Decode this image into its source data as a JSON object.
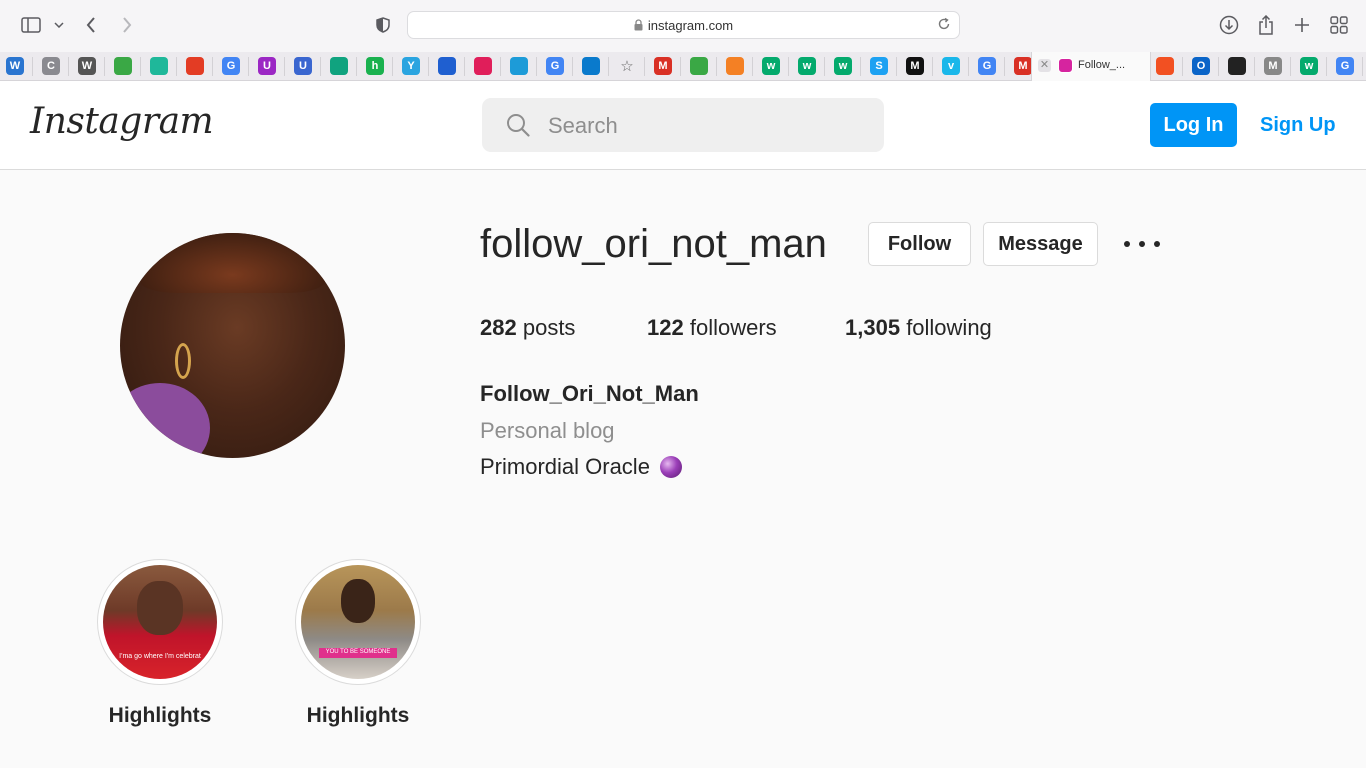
{
  "browser": {
    "url": "instagram.com",
    "active_tab_title": "Follow_..."
  },
  "favorites": [
    {
      "icon": "wordpress-icon",
      "color": "#2a75d0",
      "glyph": "W"
    },
    {
      "icon": "c-icon",
      "color": "#8a8a90",
      "glyph": "C"
    },
    {
      "icon": "w-shield-icon",
      "color": "#555",
      "glyph": "W"
    },
    {
      "icon": "book-icon",
      "color": "#3aa845",
      "glyph": ""
    },
    {
      "icon": "pentagon-icon",
      "color": "#1fb89a",
      "glyph": ""
    },
    {
      "icon": "office-icon",
      "color": "#e33c24",
      "glyph": ""
    },
    {
      "icon": "google-icon",
      "color": "#4285f4",
      "glyph": "G"
    },
    {
      "icon": "u-circle-icon",
      "color": "#9b27c4",
      "glyph": "U"
    },
    {
      "icon": "u-square-icon",
      "color": "#3a66d0",
      "glyph": "U"
    },
    {
      "icon": "openai-icon",
      "color": "#10a37f",
      "glyph": ""
    },
    {
      "icon": "h-circle-icon",
      "color": "#1ab14f",
      "glyph": "h"
    },
    {
      "icon": "y-arrow-icon",
      "color": "#2aa4e0",
      "glyph": "Y"
    },
    {
      "icon": "grid-icon",
      "color": "#1f5fd0",
      "glyph": ""
    },
    {
      "icon": "slack-icon",
      "color": "#e01e5a",
      "glyph": ""
    },
    {
      "icon": "cloud-icon",
      "color": "#1d9bd8",
      "glyph": ""
    },
    {
      "icon": "google-icon",
      "color": "#4285f4",
      "glyph": "G"
    },
    {
      "icon": "vscode-icon",
      "color": "#0a7acc",
      "glyph": ""
    },
    {
      "icon": "star-icon",
      "color": "#666",
      "glyph": "☆"
    },
    {
      "icon": "gmail-icon",
      "color": "#d93025",
      "glyph": "M"
    },
    {
      "icon": "book-icon",
      "color": "#3aa845",
      "glyph": ""
    },
    {
      "icon": "stackoverflow-icon",
      "color": "#f48024",
      "glyph": ""
    },
    {
      "icon": "w3schools-icon",
      "color": "#04aa6d",
      "glyph": "w"
    },
    {
      "icon": "w3schools-icon",
      "color": "#04aa6d",
      "glyph": "w"
    },
    {
      "icon": "w3schools-icon",
      "color": "#04aa6d",
      "glyph": "w"
    },
    {
      "icon": "s-square-icon",
      "color": "#1da1f2",
      "glyph": "S"
    },
    {
      "icon": "medium-icon",
      "color": "#111",
      "glyph": "M"
    },
    {
      "icon": "vimeo-icon",
      "color": "#1ab7ea",
      "glyph": "v"
    },
    {
      "icon": "google-icon",
      "color": "#4285f4",
      "glyph": "G"
    },
    {
      "icon": "gmail-icon",
      "color": "#d93025",
      "glyph": "M"
    },
    {
      "icon": "microsoft-icon",
      "color": "#f25022",
      "glyph": ""
    },
    {
      "icon": "outlook-icon",
      "color": "#0a64c8",
      "glyph": "O"
    },
    {
      "icon": "github-icon",
      "color": "#222",
      "glyph": ""
    },
    {
      "icon": "m-square-icon",
      "color": "#888",
      "glyph": "M"
    },
    {
      "icon": "w3schools-icon",
      "color": "#04aa6d",
      "glyph": "w"
    },
    {
      "icon": "google-icon",
      "color": "#4285f4",
      "glyph": "G"
    }
  ],
  "instagram": {
    "logo": "Instagram",
    "search_placeholder": "Search",
    "login_label": "Log In",
    "signup_label": "Sign Up",
    "accent": "#0095f6"
  },
  "profile": {
    "username": "follow_ori_not_man",
    "follow_label": "Follow",
    "message_label": "Message",
    "posts_count": "282",
    "posts_label": "posts",
    "followers_count": "122",
    "followers_label": "followers",
    "following_count": "1,305",
    "following_label": "following",
    "full_name": "Follow_Ori_Not_Man",
    "category": "Personal blog",
    "bio": "Primordial Oracle"
  },
  "highlights": [
    {
      "label": "Highlights",
      "caption": "I'ma go where I'm celebrat"
    },
    {
      "label": "Highlights",
      "caption": "YOU TO BE SOMEONE"
    }
  ]
}
